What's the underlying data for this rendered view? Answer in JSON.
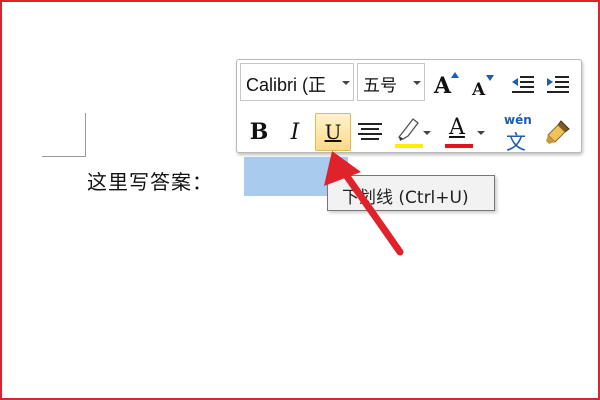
{
  "document": {
    "answer_label": "这里写答案：",
    "selection_color": "#a9cbee"
  },
  "mini_toolbar": {
    "font_name": "Calibri (正",
    "font_size": "五号",
    "grow_font": "A",
    "shrink_font": "A",
    "bold": "B",
    "italic": "I",
    "underline": "U",
    "font_color_letter": "A",
    "phonetic_top": "wén",
    "phonetic_bottom": "文",
    "highlight_color": "#ffee00",
    "font_color": "#e0141e",
    "active_button": "underline"
  },
  "tooltip": {
    "text": "下划线 (Ctrl+U)"
  },
  "annotation": {
    "arrow_color": "#e0222a"
  }
}
